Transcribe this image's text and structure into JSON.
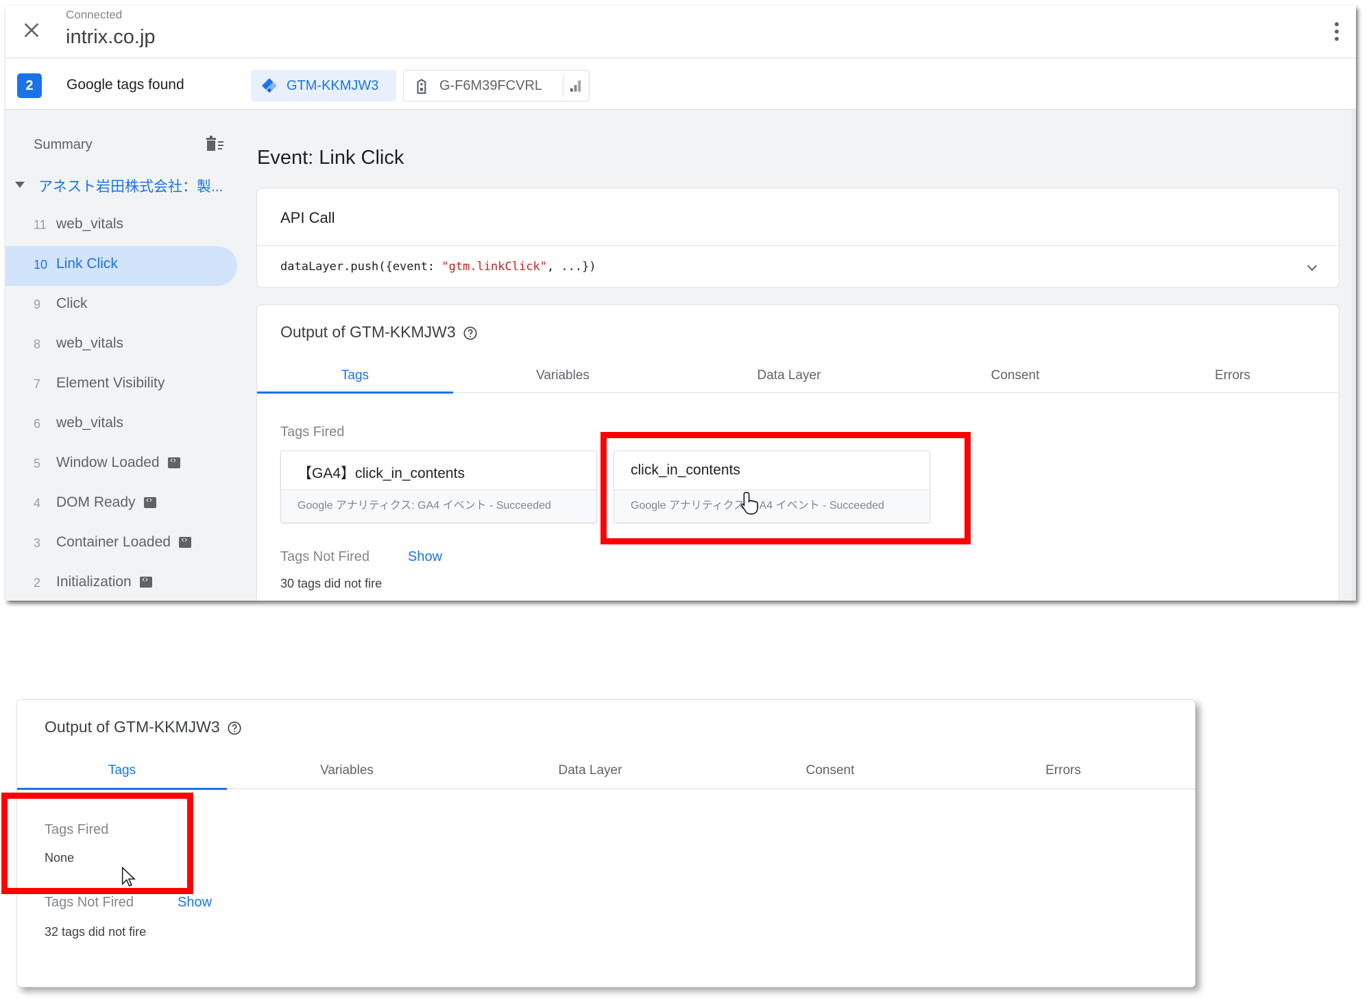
{
  "header": {
    "status": "Connected",
    "site": "intrix.co.jp"
  },
  "tagbar": {
    "count": "2",
    "label": "Google tags found",
    "containers": [
      {
        "id": "GTM-KKMJW3",
        "icon": "gtm-diamond-icon",
        "selected": true
      },
      {
        "id": "G-F6M39FCVRL",
        "icon": "ga-tag-icon",
        "selected": false
      }
    ]
  },
  "sidebar": {
    "summary": "Summary",
    "page_title": "アネスト岩田株式会社：製...",
    "events": [
      {
        "num": "11",
        "label": "web_vitals",
        "code": false,
        "active": false
      },
      {
        "num": "10",
        "label": "Link Click",
        "code": false,
        "active": true
      },
      {
        "num": "9",
        "label": "Click",
        "code": false,
        "active": false
      },
      {
        "num": "8",
        "label": "web_vitals",
        "code": false,
        "active": false
      },
      {
        "num": "7",
        "label": "Element Visibility",
        "code": false,
        "active": false
      },
      {
        "num": "6",
        "label": "web_vitals",
        "code": false,
        "active": false
      },
      {
        "num": "5",
        "label": "Window Loaded",
        "code": true,
        "active": false
      },
      {
        "num": "4",
        "label": "DOM Ready",
        "code": true,
        "active": false
      },
      {
        "num": "3",
        "label": "Container Loaded",
        "code": true,
        "active": false
      },
      {
        "num": "2",
        "label": "Initialization",
        "code": true,
        "active": false
      }
    ]
  },
  "main": {
    "event_title": "Event: Link Click",
    "api_call": {
      "title": "API Call",
      "code_prefix": "dataLayer.push({event: ",
      "code_string": "\"gtm.linkClick\"",
      "code_suffix": ", ...})"
    },
    "output": {
      "title": "Output of GTM-KKMJW3",
      "tabs": [
        "Tags",
        "Variables",
        "Data Layer",
        "Consent",
        "Errors"
      ],
      "active_tab": "Tags",
      "tags_fired_label": "Tags Fired",
      "tags_fired": [
        {
          "name": "【GA4】click_in_contents",
          "status": "Google アナリティクス: GA4 イベント - Succeeded"
        },
        {
          "name": "click_in_contents",
          "status": "Google アナリティクス: GA4 イベント - Succeeded"
        }
      ],
      "tags_not_fired_label": "Tags Not Fired",
      "show_label": "Show",
      "not_fired_count": "30 tags did not fire"
    }
  },
  "bottom": {
    "title": "Output of GTM-KKMJW3",
    "tabs": [
      "Tags",
      "Variables",
      "Data Layer",
      "Consent",
      "Errors"
    ],
    "tags_fired_label": "Tags Fired",
    "tags_fired_value": "None",
    "tags_not_fired_label": "Tags Not Fired",
    "show_label": "Show",
    "not_fired_count": "32 tags did not fire"
  },
  "colors": {
    "accent": "#1a73e8",
    "highlight": "#ff0000",
    "selected_bg": "#d2e3fc"
  }
}
